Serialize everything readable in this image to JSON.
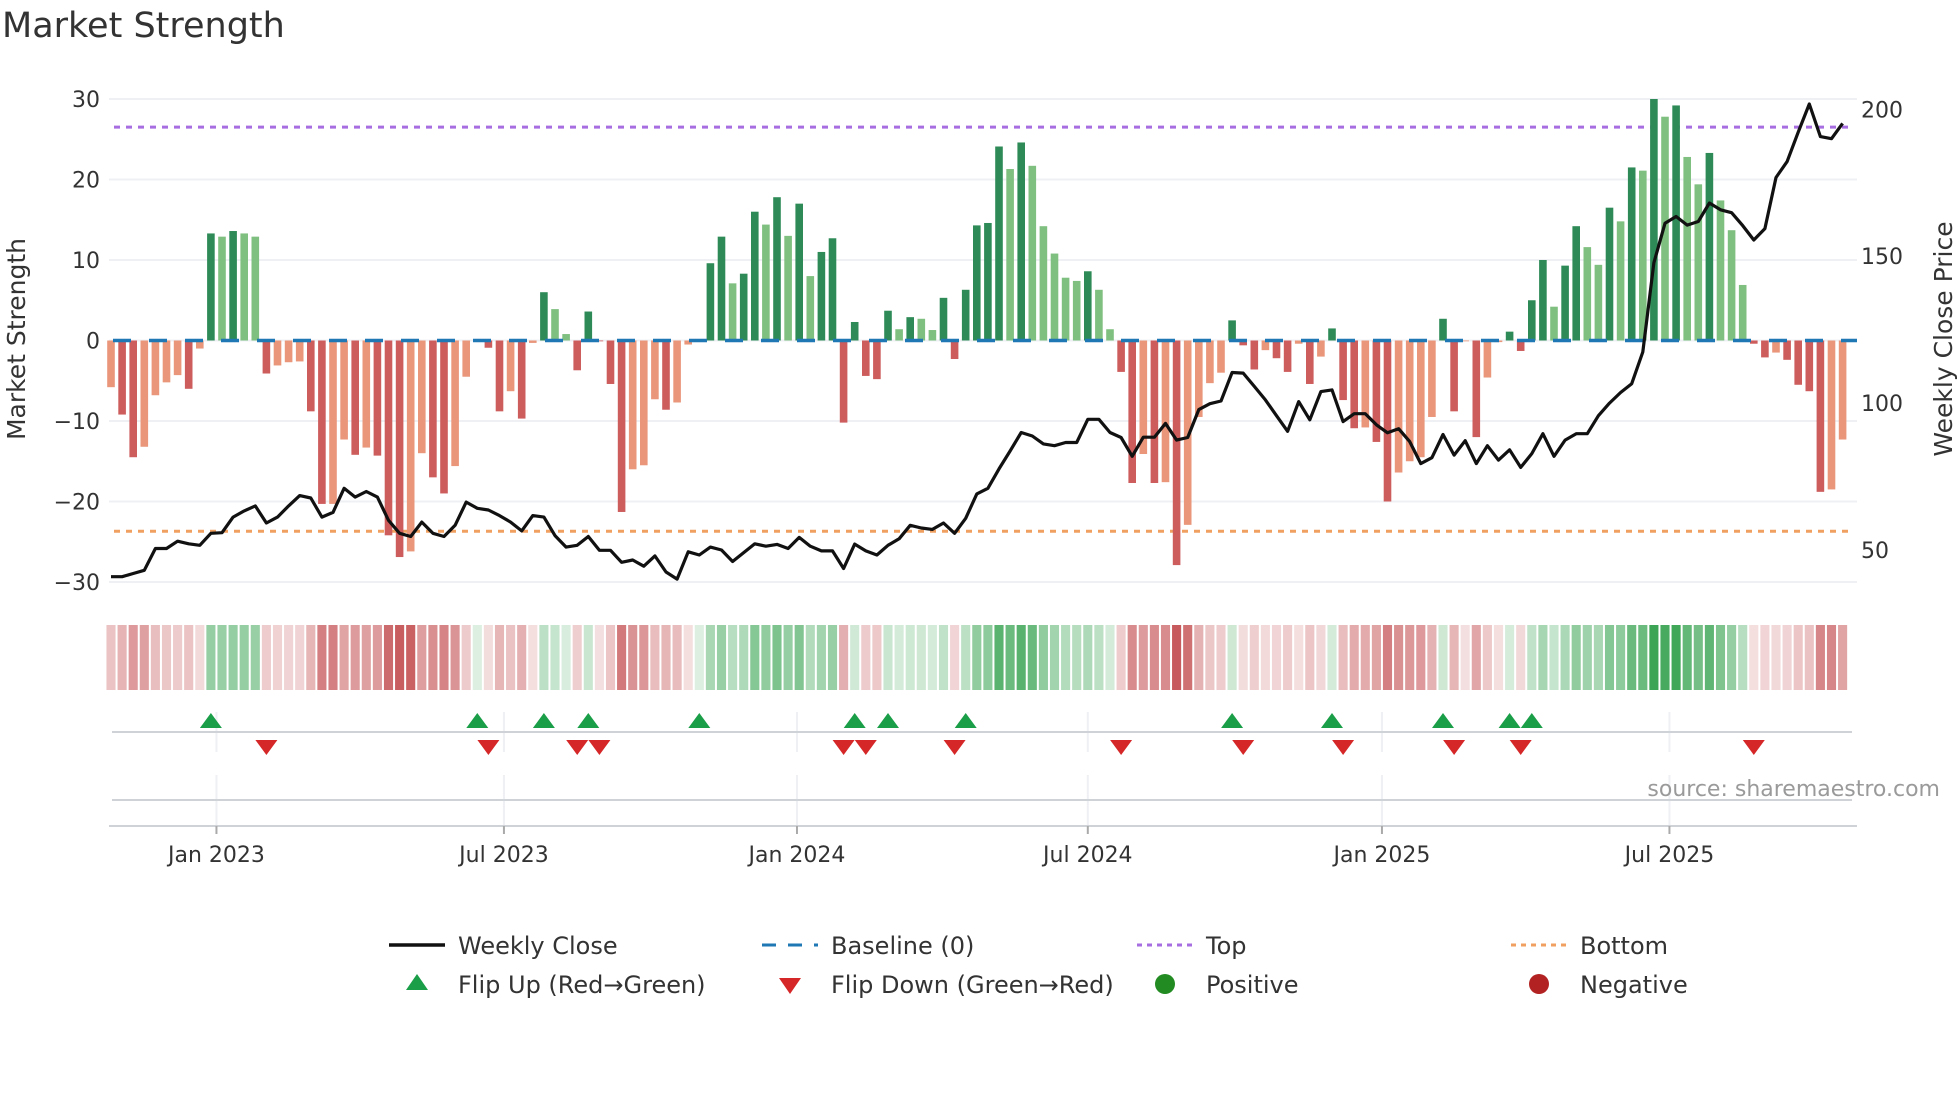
{
  "title": "Market Strength",
  "source": "source: sharemaestro.com",
  "colors": {
    "pos_up": "#2e8b57",
    "pos_down": "#7fbf7f",
    "neg_down": "#cd5c5c",
    "neg_up": "#e9967a",
    "line": "#111111",
    "baseline": "#1f77b4",
    "top": "#a66ee0",
    "bottom": "#f0a060",
    "flip_up": "#1a9e48",
    "flip_down": "#d62728",
    "positive": "#228b22",
    "negative": "#b22222"
  },
  "chart_data": {
    "type": "bar",
    "title": "Market Strength",
    "ylabel": "Market Strength",
    "y2label": "Weekly Close Price",
    "ylim": [
      -33,
      33
    ],
    "y2lim": [
      31,
      212
    ],
    "yticks": [
      30,
      20,
      10,
      0,
      -10,
      -20,
      -30
    ],
    "ytick_labels": [
      "30",
      "20",
      "10",
      "0",
      "−10",
      "−20",
      "−30"
    ],
    "y2ticks": [
      200,
      150,
      100,
      50
    ],
    "y2tick_labels": [
      "200",
      "150",
      "100",
      "50"
    ],
    "x_unit": "week index (1-based, weekly bars)",
    "x_ticks": [
      {
        "label": "Jan 2023",
        "week": 10.5
      },
      {
        "label": "Jul 2023",
        "week": 36.4
      },
      {
        "label": "Jan 2024",
        "week": 62.8
      },
      {
        "label": "Jul 2024",
        "week": 89.0
      },
      {
        "label": "Jan 2025",
        "week": 115.5
      },
      {
        "label": "Jul 2025",
        "week": 141.4
      }
    ],
    "top_level": 26.5,
    "bottom_level": -23.7,
    "strength": [
      -5.8,
      -9.2,
      -14.5,
      -13.2,
      -6.8,
      -5.2,
      -4.3,
      -6.0,
      -1.0,
      13.3,
      12.9,
      13.6,
      13.3,
      12.9,
      -4.1,
      -3.1,
      -2.7,
      -2.6,
      -8.8,
      -20.3,
      -20.3,
      -12.3,
      -14.2,
      -13.3,
      -14.3,
      -24.2,
      -26.9,
      -26.2,
      -14.0,
      -17.0,
      -19.0,
      -15.6,
      -4.5,
      0.1,
      -0.9,
      -8.8,
      -6.3,
      -9.7,
      -0.3,
      6.0,
      3.9,
      0.8,
      -3.7,
      3.6,
      -0.1,
      -5.4,
      -21.3,
      -16.0,
      -15.5,
      -7.3,
      -8.6,
      -7.7,
      -0.5,
      0.1,
      9.6,
      12.9,
      7.1,
      8.3,
      16.0,
      14.4,
      17.8,
      13.0,
      17.0,
      8.0,
      11.0,
      12.7,
      -10.2,
      2.3,
      -4.4,
      -4.8,
      3.7,
      1.4,
      2.9,
      2.7,
      1.3,
      5.3,
      -2.3,
      6.3,
      14.3,
      14.6,
      24.1,
      21.3,
      24.6,
      21.7,
      14.2,
      10.8,
      7.8,
      7.4,
      8.6,
      6.3,
      1.4,
      -3.9,
      -17.7,
      -14.1,
      -17.7,
      -17.6,
      -27.9,
      -22.9,
      -9.5,
      -5.3,
      -4.0,
      2.5,
      -0.6,
      -3.6,
      -1.2,
      -2.2,
      -3.9,
      -0.4,
      -5.4,
      -2.0,
      1.5,
      -7.4,
      -10.9,
      -10.8,
      -12.6,
      -20.0,
      -16.4,
      -15.0,
      -14.5,
      -9.5,
      2.7,
      -8.8,
      -0.1,
      -12.0,
      -4.6,
      -0.2,
      1.1,
      -1.3,
      5.0,
      10.0,
      4.2,
      9.3,
      14.2,
      11.6,
      9.4,
      16.5,
      14.8,
      21.5,
      21.1,
      30.0,
      27.8,
      29.2,
      22.8,
      19.4,
      23.3,
      17.4,
      13.7,
      6.9,
      -0.4,
      -2.1,
      -1.5,
      -2.4,
      -5.5,
      -6.3,
      -18.8,
      -18.5,
      -12.3
    ],
    "weekly_close": [
      40.9,
      40.9,
      42.0,
      43.1,
      50.5,
      50.5,
      53.0,
      52.1,
      51.6,
      55.7,
      55.9,
      61.2,
      63.3,
      65.0,
      59.2,
      61.2,
      65.0,
      68.5,
      67.7,
      61.2,
      62.8,
      71.0,
      68.0,
      69.9,
      68.0,
      60.1,
      55.7,
      54.6,
      59.5,
      55.7,
      54.6,
      58.4,
      66.3,
      64.2,
      63.6,
      61.7,
      59.5,
      56.5,
      61.7,
      61.2,
      54.9,
      51.0,
      51.6,
      54.6,
      49.9,
      49.9,
      45.8,
      46.6,
      44.5,
      48.0,
      42.5,
      40.1,
      49.4,
      48.3,
      51.0,
      50.0,
      46.1,
      49.1,
      52.1,
      51.3,
      51.9,
      50.5,
      54.3,
      51.3,
      49.7,
      49.7,
      43.7,
      52.0,
      49.7,
      48.3,
      51.6,
      53.8,
      58.4,
      57.5,
      57.0,
      59.2,
      55.7,
      60.8,
      69.1,
      71.0,
      77.6,
      83.7,
      90.0,
      88.8,
      86.1,
      85.5,
      86.6,
      86.6,
      94.5,
      94.5,
      90.0,
      88.3,
      81.9,
      88.4,
      88.4,
      93.1,
      87.4,
      88.3,
      97.8,
      99.8,
      100.7,
      110.4,
      110.2,
      105.7,
      101.1,
      95.7,
      90.4,
      100.5,
      94.3,
      103.9,
      104.5,
      93.7,
      96.4,
      96.4,
      92.6,
      89.9,
      91.3,
      86.9,
      79.4,
      81.4,
      89.3,
      82.3,
      87.2,
      79.4,
      85.5,
      80.6,
      84.1,
      78.1,
      82.8,
      89.6,
      81.9,
      87.4,
      89.6,
      89.6,
      95.7,
      100.0,
      103.6,
      106.6,
      117.4,
      147.8,
      161.2,
      163.5,
      160.6,
      161.8,
      168.1,
      165.8,
      164.8,
      160.4,
      155.5,
      159.4,
      176.8,
      182.2,
      192.2,
      201.8,
      190.7,
      190.0,
      195.2
    ],
    "flips_up": [
      10,
      34,
      40,
      44,
      54,
      68,
      71,
      78,
      102,
      111,
      121,
      127,
      129
    ],
    "flips_down": [
      15,
      35,
      43,
      45,
      67,
      69,
      77,
      92,
      103,
      112,
      122,
      128,
      149
    ],
    "legend": [
      {
        "label": "Weekly Close",
        "kind": "line"
      },
      {
        "label": "Baseline (0)",
        "kind": "dash"
      },
      {
        "label": "Top",
        "kind": "dot-purple"
      },
      {
        "label": "Bottom",
        "kind": "dot-orange"
      },
      {
        "label": "Flip Up (Red→Green)",
        "kind": "tri-up"
      },
      {
        "label": "Flip Down (Green→Red)",
        "kind": "tri-down"
      },
      {
        "label": "Positive",
        "kind": "circle-pos"
      },
      {
        "label": "Negative",
        "kind": "circle-neg"
      }
    ],
    "legend_position": "bottom"
  }
}
